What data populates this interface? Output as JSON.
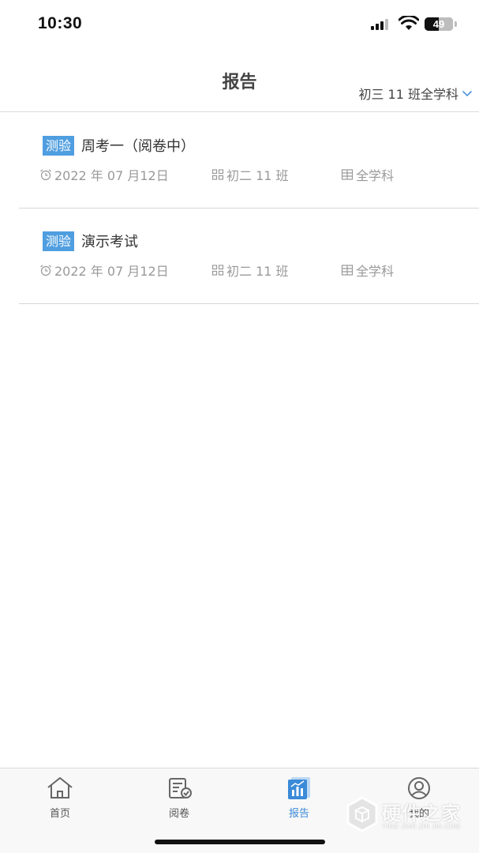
{
  "status_bar": {
    "time": "10:30",
    "battery_level": "49"
  },
  "header": {
    "title": "报告",
    "class_filter": "初三 11 班全学科"
  },
  "reports": [
    {
      "tag": "测验",
      "title": "周考一（阅卷中）",
      "date": "2022 年 07 月12日",
      "class": "初二 11 班",
      "subject": "全学科"
    },
    {
      "tag": "测验",
      "title": "演示考试",
      "date": "2022 年 07 月12日",
      "class": "初二 11 班",
      "subject": "全学科"
    }
  ],
  "tabbar": {
    "items": [
      {
        "label": "首页",
        "icon": "home-icon"
      },
      {
        "label": "阅卷",
        "icon": "review-paper-icon"
      },
      {
        "label": "报告",
        "icon": "report-chart-icon",
        "active": true
      },
      {
        "label": "我的",
        "icon": "user-icon"
      }
    ]
  },
  "watermark": {
    "text": "硬件之家",
    "sub": "YING JIAN ZHI JIA.COM"
  },
  "colors": {
    "accent": "#3b8ad8",
    "tag_bg": "#4f9ee0",
    "meta_text": "#999999"
  }
}
